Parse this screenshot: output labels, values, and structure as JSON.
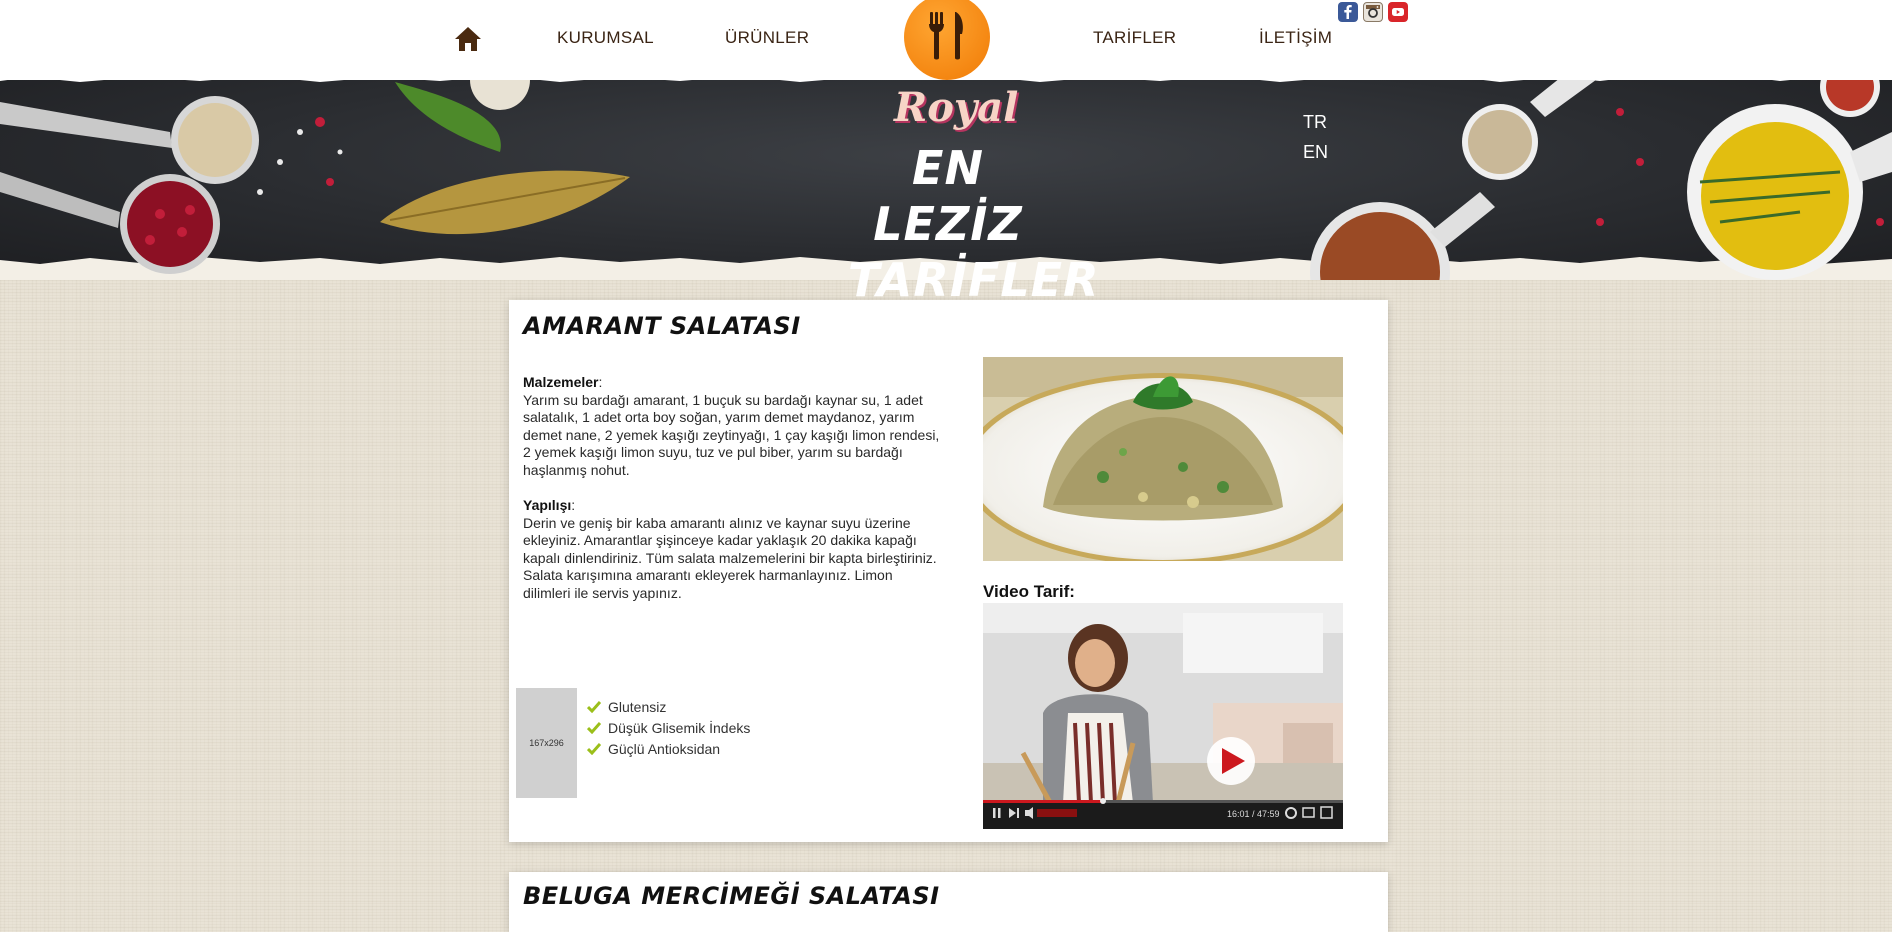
{
  "nav": {
    "home_icon": "home-icon",
    "items": [
      {
        "label": "KURUMSAL"
      },
      {
        "label": "ÜRÜNLER"
      },
      {
        "label": "TARİFLER"
      },
      {
        "label": "İLETİŞİM"
      }
    ],
    "logo_icon": "fork-knife-icon",
    "social": [
      "facebook-icon",
      "instagram-icon",
      "youtube-icon"
    ]
  },
  "banner": {
    "brand_script": "Royal",
    "title_line1": "EN LEZİZ",
    "title_line2": "TARİFLER",
    "languages": [
      "TR",
      "EN"
    ]
  },
  "recipes": [
    {
      "title": "AMARANT SALATASI",
      "ingredients_heading": "Malzemeler",
      "ingredients": "Yarım su bardağı amarant, 1 buçuk su bardağı kaynar su, 1 adet salatalık, 1 adet orta boy soğan, yarım demet maydanoz, yarım demet nane, 2 yemek kaşığı zeytinyağı, 1 çay kaşığı limon rendesi, 2 yemek kaşığı limon suyu, tuz ve pul biber, yarım su bardağı haşlanmış nohut.",
      "preparation_heading": "Yapılışı",
      "preparation": "Derin ve geniş bir kaba amarantı alınız ve kaynar suyu üzerine ekleyiniz. Amarantlar şişinceye kadar yaklaşık 20 dakika kapağı kapalı dinlendiriniz. Tüm salata malzemelerini bir kapta birleştiriniz. Salata karışımına amarantı ekleyerek harmanlayınız. Limon dilimleri ile servis yapınız.",
      "video_label": "Video Tarif:",
      "video_time": "16:01 / 47:59",
      "placeholder_text": "167x296",
      "features": [
        "Glutensiz",
        "Düşük Glisemik İndeks",
        "Güçlü Antioksidan"
      ]
    },
    {
      "title": "BELUGA MERCİMEĞİ SALATASI"
    }
  ],
  "colors": {
    "accent": "#f07a05",
    "nav_text": "#3a2414",
    "check": "#9bbf1a",
    "page_bg": "#e9e3d6"
  }
}
